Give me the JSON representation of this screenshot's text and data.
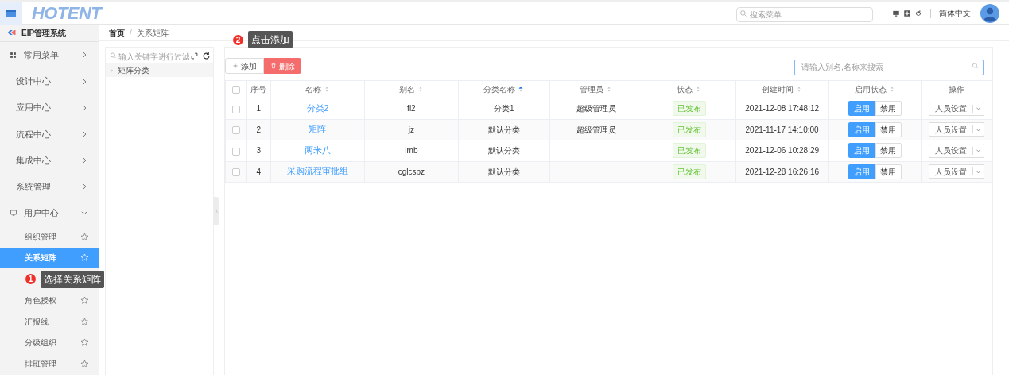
{
  "header": {
    "logo": "HOTENT",
    "search_placeholder": "搜索菜单",
    "language": "简体中文"
  },
  "sidebar": {
    "brand": "EIP管理系统",
    "items": [
      {
        "label": "常用菜单",
        "kind": "group",
        "expanded": false
      },
      {
        "label": "设计中心",
        "kind": "plain",
        "expanded": false
      },
      {
        "label": "应用中心",
        "kind": "plain",
        "expanded": false
      },
      {
        "label": "流程中心",
        "kind": "plain",
        "expanded": false
      },
      {
        "label": "集成中心",
        "kind": "plain",
        "expanded": false
      },
      {
        "label": "系统管理",
        "kind": "plain",
        "expanded": false
      },
      {
        "label": "用户中心",
        "kind": "group",
        "expanded": true,
        "children": [
          {
            "label": "组织管理",
            "selected": false
          },
          {
            "label": "关系矩阵",
            "selected": true
          },
          {
            "label": "角色授权",
            "selected": false
          },
          {
            "label": "汇报线",
            "selected": false
          },
          {
            "label": "分级组织",
            "selected": false
          },
          {
            "label": "排班管理",
            "selected": false
          }
        ]
      }
    ]
  },
  "breadcrumb": {
    "items": [
      "首页",
      "关系矩阵"
    ],
    "separator": "/"
  },
  "tree": {
    "filter_placeholder": "输入关键字进行过滤",
    "nodes": [
      "矩阵分类"
    ]
  },
  "toolbar": {
    "add": "添加",
    "delete": "删除",
    "search_placeholder": "请输入别名,名称来搜索"
  },
  "table": {
    "all_checked": false,
    "columns": [
      {
        "label": "序号",
        "sortable": false
      },
      {
        "label": "名称",
        "sortable": true,
        "sorted": false
      },
      {
        "label": "别名",
        "sortable": true,
        "sorted": false
      },
      {
        "label": "分类名称",
        "sortable": true,
        "sorted": true
      },
      {
        "label": "管理员",
        "sortable": true,
        "sorted": false
      },
      {
        "label": "状态",
        "sortable": true,
        "sorted": false
      },
      {
        "label": "创建时间",
        "sortable": true,
        "sorted": false
      },
      {
        "label": "启用状态",
        "sortable": true,
        "sorted": false
      },
      {
        "label": "操作",
        "sortable": false
      }
    ],
    "rows": [
      {
        "index": "1",
        "name": "分类2",
        "alias": "fl2",
        "category": "分类1",
        "admin": "超级管理员",
        "status": "已发布",
        "created": "2021-12-08 17:48:12",
        "enabled": true,
        "checked": false,
        "enable_label": "启用",
        "disable_label": "禁用",
        "action_label": "人员设置"
      },
      {
        "index": "2",
        "name": "矩阵",
        "alias": "jz",
        "category": "默认分类",
        "admin": "超级管理员",
        "status": "已发布",
        "created": "2021-11-17 14:10:00",
        "enabled": true,
        "checked": false,
        "enable_label": "启用",
        "disable_label": "禁用",
        "action_label": "人员设置"
      },
      {
        "index": "3",
        "name": "两米八",
        "alias": "lmb",
        "category": "默认分类",
        "status": "已发布",
        "created": "2021-12-06 10:28:29",
        "enabled": true,
        "checked": false,
        "enable_label": "启用",
        "disable_label": "禁用",
        "action_label": "人员设置"
      },
      {
        "index": "4",
        "name": "采购流程审批组",
        "alias": "cglcspz",
        "category": "默认分类",
        "status": "已发布",
        "created": "2021-12-28 16:26:16",
        "enabled": true,
        "checked": false,
        "enable_label": "启用",
        "disable_label": "禁用",
        "action_label": "人员设置"
      }
    ]
  },
  "hints": [
    {
      "number": "1",
      "text": "选择关系矩阵"
    },
    {
      "number": "2",
      "text": "点击添加"
    }
  ]
}
